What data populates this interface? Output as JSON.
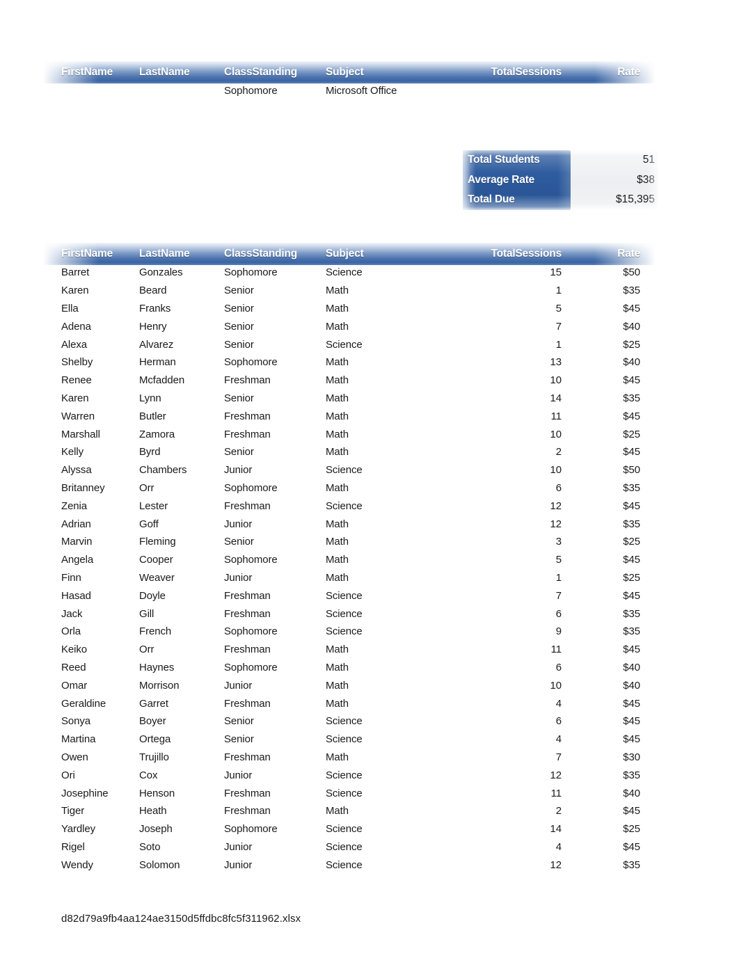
{
  "document": {
    "filename": "d82d79a9fb4aa124ae3150d5ffdbc8fc5f311962.xlsx"
  },
  "columns": {
    "first_name": "FirstName",
    "last_name": "LastName",
    "class_standing": "ClassStanding",
    "subject": "Subject",
    "total_sessions": "TotalSessions",
    "rate": "Rate"
  },
  "top_table": {
    "rows": [
      {
        "first_name": "",
        "last_name": "",
        "class_standing": "Sophomore",
        "subject": "Microsoft Office",
        "total_sessions": "",
        "rate": ""
      }
    ]
  },
  "summary": {
    "rows": [
      {
        "label": "Total Students",
        "value": "51"
      },
      {
        "label": "Average Rate",
        "value": "$38"
      },
      {
        "label": "Total Due",
        "value": "$15,395"
      }
    ]
  },
  "main_table": {
    "rows": [
      {
        "first_name": "Barret",
        "last_name": "Gonzales",
        "class_standing": "Sophomore",
        "subject": "Science",
        "total_sessions": "15",
        "rate": "$50"
      },
      {
        "first_name": "Karen",
        "last_name": "Beard",
        "class_standing": "Senior",
        "subject": "Math",
        "total_sessions": "1",
        "rate": "$35"
      },
      {
        "first_name": "Ella",
        "last_name": "Franks",
        "class_standing": "Senior",
        "subject": "Math",
        "total_sessions": "5",
        "rate": "$45"
      },
      {
        "first_name": "Adena",
        "last_name": "Henry",
        "class_standing": "Senior",
        "subject": "Math",
        "total_sessions": "7",
        "rate": "$40"
      },
      {
        "first_name": "Alexa",
        "last_name": "Alvarez",
        "class_standing": "Senior",
        "subject": "Science",
        "total_sessions": "1",
        "rate": "$25"
      },
      {
        "first_name": "Shelby",
        "last_name": "Herman",
        "class_standing": "Sophomore",
        "subject": "Math",
        "total_sessions": "13",
        "rate": "$40"
      },
      {
        "first_name": "Renee",
        "last_name": "Mcfadden",
        "class_standing": "Freshman",
        "subject": "Math",
        "total_sessions": "10",
        "rate": "$45"
      },
      {
        "first_name": "Karen",
        "last_name": "Lynn",
        "class_standing": "Senior",
        "subject": "Math",
        "total_sessions": "14",
        "rate": "$35"
      },
      {
        "first_name": "Warren",
        "last_name": "Butler",
        "class_standing": "Freshman",
        "subject": "Math",
        "total_sessions": "11",
        "rate": "$45"
      },
      {
        "first_name": "Marshall",
        "last_name": "Zamora",
        "class_standing": "Freshman",
        "subject": "Math",
        "total_sessions": "10",
        "rate": "$25"
      },
      {
        "first_name": "Kelly",
        "last_name": "Byrd",
        "class_standing": "Senior",
        "subject": "Math",
        "total_sessions": "2",
        "rate": "$45"
      },
      {
        "first_name": "Alyssa",
        "last_name": "Chambers",
        "class_standing": "Junior",
        "subject": "Science",
        "total_sessions": "10",
        "rate": "$50"
      },
      {
        "first_name": "Britanney",
        "last_name": "Orr",
        "class_standing": "Sophomore",
        "subject": "Math",
        "total_sessions": "6",
        "rate": "$35"
      },
      {
        "first_name": "Zenia",
        "last_name": "Lester",
        "class_standing": "Freshman",
        "subject": "Science",
        "total_sessions": "12",
        "rate": "$45"
      },
      {
        "first_name": "Adrian",
        "last_name": "Goff",
        "class_standing": "Junior",
        "subject": "Math",
        "total_sessions": "12",
        "rate": "$35"
      },
      {
        "first_name": "Marvin",
        "last_name": "Fleming",
        "class_standing": "Senior",
        "subject": "Math",
        "total_sessions": "3",
        "rate": "$25"
      },
      {
        "first_name": "Angela",
        "last_name": "Cooper",
        "class_standing": "Sophomore",
        "subject": "Math",
        "total_sessions": "5",
        "rate": "$45"
      },
      {
        "first_name": "Finn",
        "last_name": "Weaver",
        "class_standing": "Junior",
        "subject": "Math",
        "total_sessions": "1",
        "rate": "$25"
      },
      {
        "first_name": "Hasad",
        "last_name": "Doyle",
        "class_standing": "Freshman",
        "subject": "Science",
        "total_sessions": "7",
        "rate": "$45"
      },
      {
        "first_name": "Jack",
        "last_name": "Gill",
        "class_standing": "Freshman",
        "subject": "Science",
        "total_sessions": "6",
        "rate": "$35"
      },
      {
        "first_name": "Orla",
        "last_name": "French",
        "class_standing": "Sophomore",
        "subject": "Science",
        "total_sessions": "9",
        "rate": "$35"
      },
      {
        "first_name": "Keiko",
        "last_name": "Orr",
        "class_standing": "Freshman",
        "subject": "Math",
        "total_sessions": "11",
        "rate": "$45"
      },
      {
        "first_name": "Reed",
        "last_name": "Haynes",
        "class_standing": "Sophomore",
        "subject": "Math",
        "total_sessions": "6",
        "rate": "$40"
      },
      {
        "first_name": "Omar",
        "last_name": "Morrison",
        "class_standing": "Junior",
        "subject": "Math",
        "total_sessions": "10",
        "rate": "$40"
      },
      {
        "first_name": "Geraldine",
        "last_name": "Garret",
        "class_standing": "Freshman",
        "subject": "Math",
        "total_sessions": "4",
        "rate": "$45"
      },
      {
        "first_name": "Sonya",
        "last_name": "Boyer",
        "class_standing": "Senior",
        "subject": "Science",
        "total_sessions": "6",
        "rate": "$45"
      },
      {
        "first_name": "Martina",
        "last_name": "Ortega",
        "class_standing": "Senior",
        "subject": "Science",
        "total_sessions": "4",
        "rate": "$45"
      },
      {
        "first_name": "Owen",
        "last_name": "Trujillo",
        "class_standing": "Freshman",
        "subject": "Math",
        "total_sessions": "7",
        "rate": "$30"
      },
      {
        "first_name": "Ori",
        "last_name": "Cox",
        "class_standing": "Junior",
        "subject": "Science",
        "total_sessions": "12",
        "rate": "$35"
      },
      {
        "first_name": "Josephine",
        "last_name": "Henson",
        "class_standing": "Freshman",
        "subject": "Science",
        "total_sessions": "11",
        "rate": "$40"
      },
      {
        "first_name": "Tiger",
        "last_name": "Heath",
        "class_standing": "Freshman",
        "subject": "Math",
        "total_sessions": "2",
        "rate": "$45"
      },
      {
        "first_name": "Yardley",
        "last_name": "Joseph",
        "class_standing": "Sophomore",
        "subject": "Science",
        "total_sessions": "14",
        "rate": "$25"
      },
      {
        "first_name": "Rigel",
        "last_name": "Soto",
        "class_standing": "Junior",
        "subject": "Science",
        "total_sessions": "4",
        "rate": "$45"
      },
      {
        "first_name": "Wendy",
        "last_name": "Solomon",
        "class_standing": "Junior",
        "subject": "Science",
        "total_sessions": "12",
        "rate": "$35"
      }
    ]
  },
  "colors": {
    "header_blue_dark": "#3a63a2",
    "header_blue_light": "#ccd8ea",
    "summary_blue": "#2e5c9e",
    "summary_value_bg": "#eceef1",
    "text": "#1a1a1a"
  }
}
